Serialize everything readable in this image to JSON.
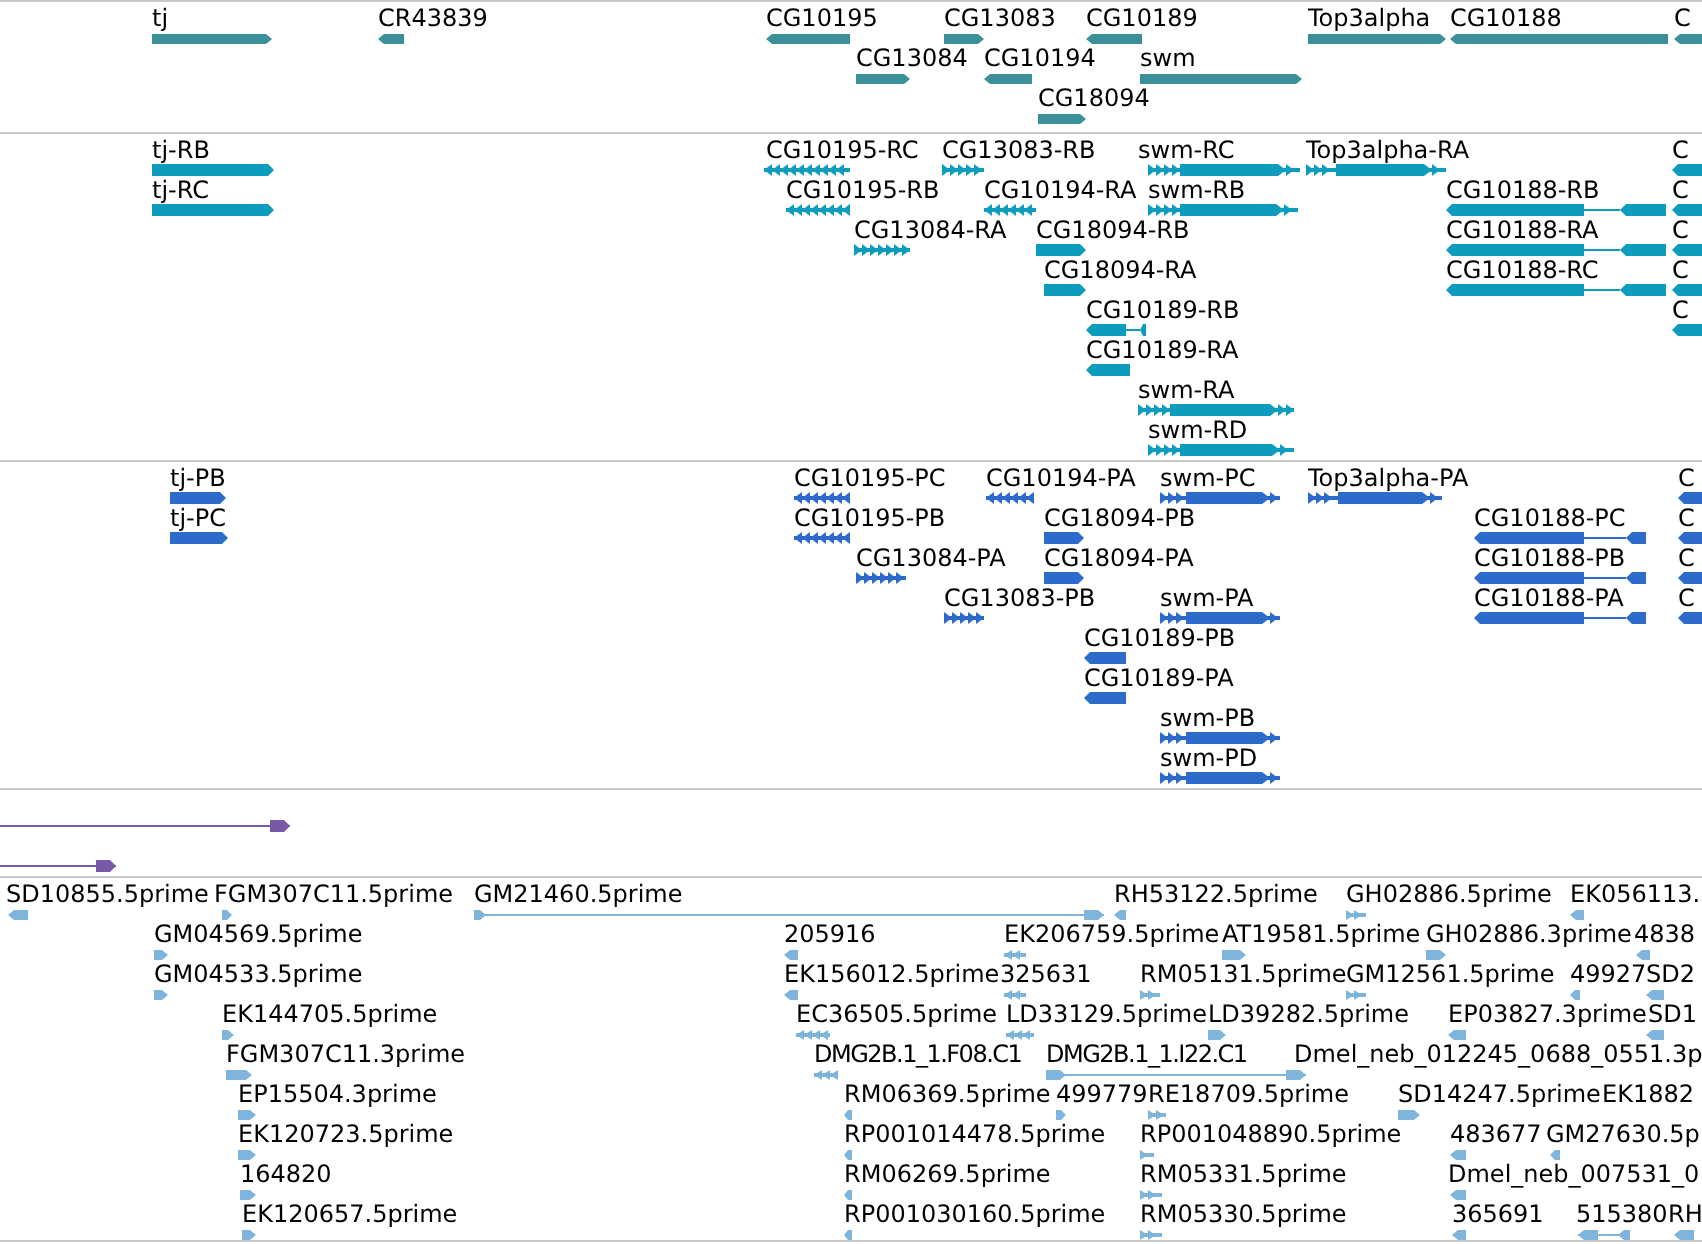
{
  "tracks": [
    {
      "color": "#3a8f99",
      "features": [
        {
          "label": "tj",
          "reverse": false
        },
        {
          "label": "CR43839",
          "reverse": true
        },
        {
          "label": "CG10195",
          "reverse": true
        },
        {
          "label": "CG13083",
          "reverse": false
        },
        {
          "label": "CG10189",
          "reverse": true
        },
        {
          "label": "Top3alpha",
          "reverse": false
        },
        {
          "label": "CG10188",
          "reverse": true
        },
        {
          "label": "C",
          "reverse": true
        },
        {
          "label": "CG13084",
          "reverse": false
        },
        {
          "label": "CG10194",
          "reverse": true
        },
        {
          "label": "swm",
          "reverse": false
        },
        {
          "label": "CG18094",
          "reverse": false
        }
      ]
    },
    {
      "color": "#0e9cbe",
      "features": [
        {
          "label": "tj-RB",
          "reverse": false
        },
        {
          "label": "CG10195-RC",
          "reverse": true
        },
        {
          "label": "CG13083-RB",
          "reverse": false
        },
        {
          "label": "swm-RC",
          "reverse": false
        },
        {
          "label": "Top3alpha-RA",
          "reverse": false
        },
        {
          "label": "C",
          "reverse": true
        },
        {
          "label": "tj-RC",
          "reverse": false
        },
        {
          "label": "CG10195-RB",
          "reverse": true
        },
        {
          "label": "CG10194-RA",
          "reverse": true
        },
        {
          "label": "swm-RB",
          "reverse": false
        },
        {
          "label": "CG10188-RB",
          "reverse": true
        },
        {
          "label": "C",
          "reverse": true
        },
        {
          "label": "CG13084-RA",
          "reverse": false
        },
        {
          "label": "CG18094-RB",
          "reverse": false
        },
        {
          "label": "CG10188-RA",
          "reverse": true
        },
        {
          "label": "C",
          "reverse": true
        },
        {
          "label": "CG18094-RA",
          "reverse": false
        },
        {
          "label": "CG10188-RC",
          "reverse": true
        },
        {
          "label": "C",
          "reverse": true
        },
        {
          "label": "CG10189-RB",
          "reverse": true
        },
        {
          "label": "C",
          "reverse": true
        },
        {
          "label": "CG10189-RA",
          "reverse": true
        },
        {
          "label": "swm-RA",
          "reverse": false
        },
        {
          "label": "swm-RD",
          "reverse": false
        }
      ]
    },
    {
      "color": "#2c6bcc",
      "features": [
        {
          "label": "tj-PB",
          "reverse": false
        },
        {
          "label": "CG10195-PC",
          "reverse": true
        },
        {
          "label": "CG10194-PA",
          "reverse": true
        },
        {
          "label": "swm-PC",
          "reverse": false
        },
        {
          "label": "Top3alpha-PA",
          "reverse": false
        },
        {
          "label": "C",
          "reverse": true
        },
        {
          "label": "tj-PC",
          "reverse": false
        },
        {
          "label": "CG10195-PB",
          "reverse": true
        },
        {
          "label": "CG18094-PB",
          "reverse": false
        },
        {
          "label": "CG10188-PC",
          "reverse": true
        },
        {
          "label": "C",
          "reverse": true
        },
        {
          "label": "CG13084-PA",
          "reverse": false
        },
        {
          "label": "CG18094-PA",
          "reverse": false
        },
        {
          "label": "CG10188-PB",
          "reverse": true
        },
        {
          "label": "C",
          "reverse": true
        },
        {
          "label": "CG13083-PB",
          "reverse": false
        },
        {
          "label": "swm-PA",
          "reverse": false
        },
        {
          "label": "CG10188-PA",
          "reverse": true
        },
        {
          "label": "C",
          "reverse": true
        },
        {
          "label": "CG10189-PB",
          "reverse": true
        },
        {
          "label": "CG10189-PA",
          "reverse": true
        },
        {
          "label": "swm-PB",
          "reverse": false
        },
        {
          "label": "swm-PD",
          "reverse": false
        }
      ]
    },
    {
      "color": "#7759a8",
      "features": [
        {
          "reverse": false
        },
        {
          "reverse": false
        }
      ]
    },
    {
      "color": "#7fb5dd",
      "features": [
        {
          "label": "SD10855.5prime",
          "reverse": true
        },
        {
          "label": "FGM307C11.5prime",
          "reverse": false
        },
        {
          "label": "GM21460.5prime",
          "reverse": false
        },
        {
          "label": "RH53122.5prime",
          "reverse": true
        },
        {
          "label": "GH02886.5prime",
          "reverse": false
        },
        {
          "label": "EK056113.",
          "reverse": true
        },
        {
          "label": "GM04569.5prime",
          "reverse": false
        },
        {
          "label": "205916",
          "reverse": true
        },
        {
          "label": "EK206759.5prime",
          "reverse": true
        },
        {
          "label": "AT19581.5prime",
          "reverse": false
        },
        {
          "label": "GH02886.3prime",
          "reverse": false
        },
        {
          "label": "4838",
          "reverse": true
        },
        {
          "label": "GM04533.5prime",
          "reverse": false
        },
        {
          "label": "EK156012.5prime",
          "reverse": true
        },
        {
          "label": "325631",
          "reverse": true
        },
        {
          "label": "RM05131.5prime",
          "reverse": false
        },
        {
          "label": "GM12561.5prime",
          "reverse": false
        },
        {
          "label": "49927",
          "reverse": true
        },
        {
          "label": "SD2",
          "reverse": true
        },
        {
          "label": "EK144705.5prime",
          "reverse": false
        },
        {
          "label": "EC36505.5prime",
          "reverse": true
        },
        {
          "label": "LD33129.5prime",
          "reverse": true
        },
        {
          "label": "LD39282.5prime",
          "reverse": false
        },
        {
          "label": "EP03827.3prime",
          "reverse": true
        },
        {
          "label": "SD1",
          "reverse": true
        },
        {
          "label": "FGM307C11.3prime",
          "reverse": false
        },
        {
          "label": "DMG2B.1_1.F08.C1",
          "reverse": true
        },
        {
          "label": "DMG2B.1_1.I22.C1",
          "reverse": false
        },
        {
          "label": "Dmel_neb_012245_0688_0551.3p"
        },
        {
          "label": "EP15504.3prime",
          "reverse": false
        },
        {
          "label": "RM06369.5prime",
          "reverse": true
        },
        {
          "label": "499779",
          "reverse": false
        },
        {
          "label": "RE18709.5prime",
          "reverse": false
        },
        {
          "label": "SD14247.5prime",
          "reverse": false
        },
        {
          "label": "EK1882"
        },
        {
          "label": "EK120723.5prime",
          "reverse": false
        },
        {
          "label": "RP001014478.5prime",
          "reverse": true
        },
        {
          "label": "RP001048890.5prime",
          "reverse": false
        },
        {
          "label": "483677",
          "reverse": true
        },
        {
          "label": "GM27630.5p",
          "reverse": true
        },
        {
          "label": "164820",
          "reverse": false
        },
        {
          "label": "RM06269.5prime",
          "reverse": true
        },
        {
          "label": "RM05331.5prime",
          "reverse": false
        },
        {
          "label": "Dmel_neb_007531_0",
          "reverse": true
        },
        {
          "label": "EK120657.5prime",
          "reverse": false
        },
        {
          "label": "RP001030160.5prime",
          "reverse": true
        },
        {
          "label": "RM05330.5prime",
          "reverse": false
        },
        {
          "label": "365691",
          "reverse": true
        },
        {
          "label": "515380",
          "reverse": true
        },
        {
          "label": "RH",
          "reverse": true
        }
      ]
    }
  ]
}
